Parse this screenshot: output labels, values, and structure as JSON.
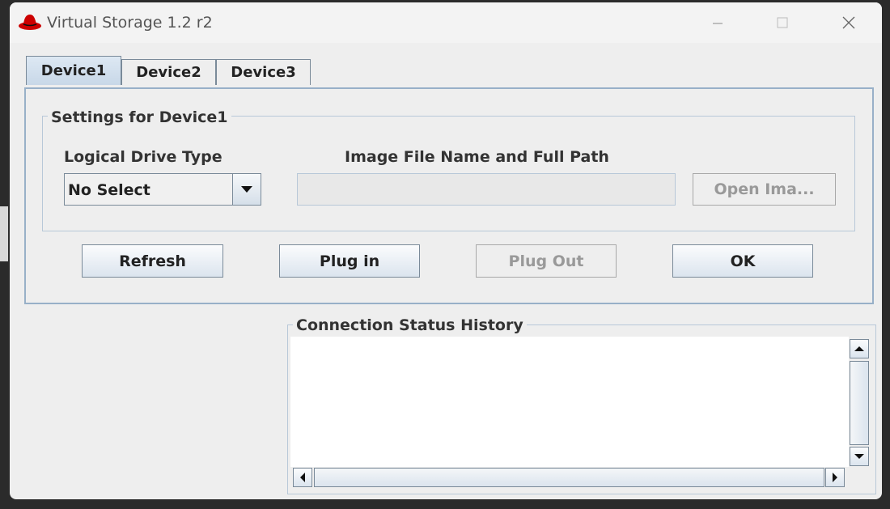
{
  "window": {
    "title": "Virtual Storage 1.2 r2",
    "accent_color": "#cc0000"
  },
  "tabs": [
    {
      "label": "Device1",
      "active": true
    },
    {
      "label": "Device2",
      "active": false
    },
    {
      "label": "Device3",
      "active": false
    }
  ],
  "settings": {
    "group_title": "Settings for Device1",
    "drive_type_label": "Logical Drive Type",
    "drive_type_value": "No Select",
    "image_path_label": "Image File Name and Full Path",
    "image_path_value": "",
    "open_image_label": "Open Ima..."
  },
  "actions": {
    "refresh_label": "Refresh",
    "plug_in_label": "Plug in",
    "plug_out_label": "Plug Out",
    "ok_label": "OK"
  },
  "status": {
    "title": "Connection Status History"
  },
  "icons": {
    "logo": "redhat-logo-icon",
    "minimize": "minimize-icon",
    "maximize": "maximize-icon",
    "close": "close-icon",
    "dropdown": "chevron-down-icon"
  }
}
